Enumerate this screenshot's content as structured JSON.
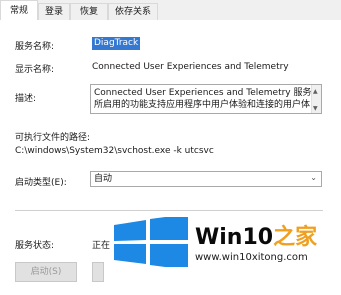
{
  "tabs": [
    {
      "label": "常规",
      "active": true
    },
    {
      "label": "登录",
      "active": false
    },
    {
      "label": "恢复",
      "active": false
    },
    {
      "label": "依存关系",
      "active": false
    }
  ],
  "general": {
    "service_name_label": "服务名称:",
    "service_name_value": "DiagTrack",
    "display_name_label": "显示名称:",
    "display_name_value": "Connected User Experiences and Telemetry",
    "description_label": "描述:",
    "description_line1": "Connected User Experiences and Telemetry 服务",
    "description_line2": "所启用的功能支持应用程序中用户体验和连接的用户体",
    "exe_path_label": "可执行文件的路径:",
    "exe_path_value": "C:\\windows\\System32\\svchost.exe -k utcsvc",
    "startup_type_label": "启动类型(E):",
    "startup_type_value": "自动",
    "service_status_label": "服务状态:",
    "service_status_value": "正在"
  },
  "buttons": {
    "start_label": "启动(S)"
  },
  "watermark": {
    "brand_text": "Win10",
    "brand_suffix": "之家",
    "url": "www.win10xitong.com"
  },
  "colors": {
    "selection": "#3478d1",
    "logo_blue": "#1e88e5",
    "logo_accent": "#f0a020"
  }
}
